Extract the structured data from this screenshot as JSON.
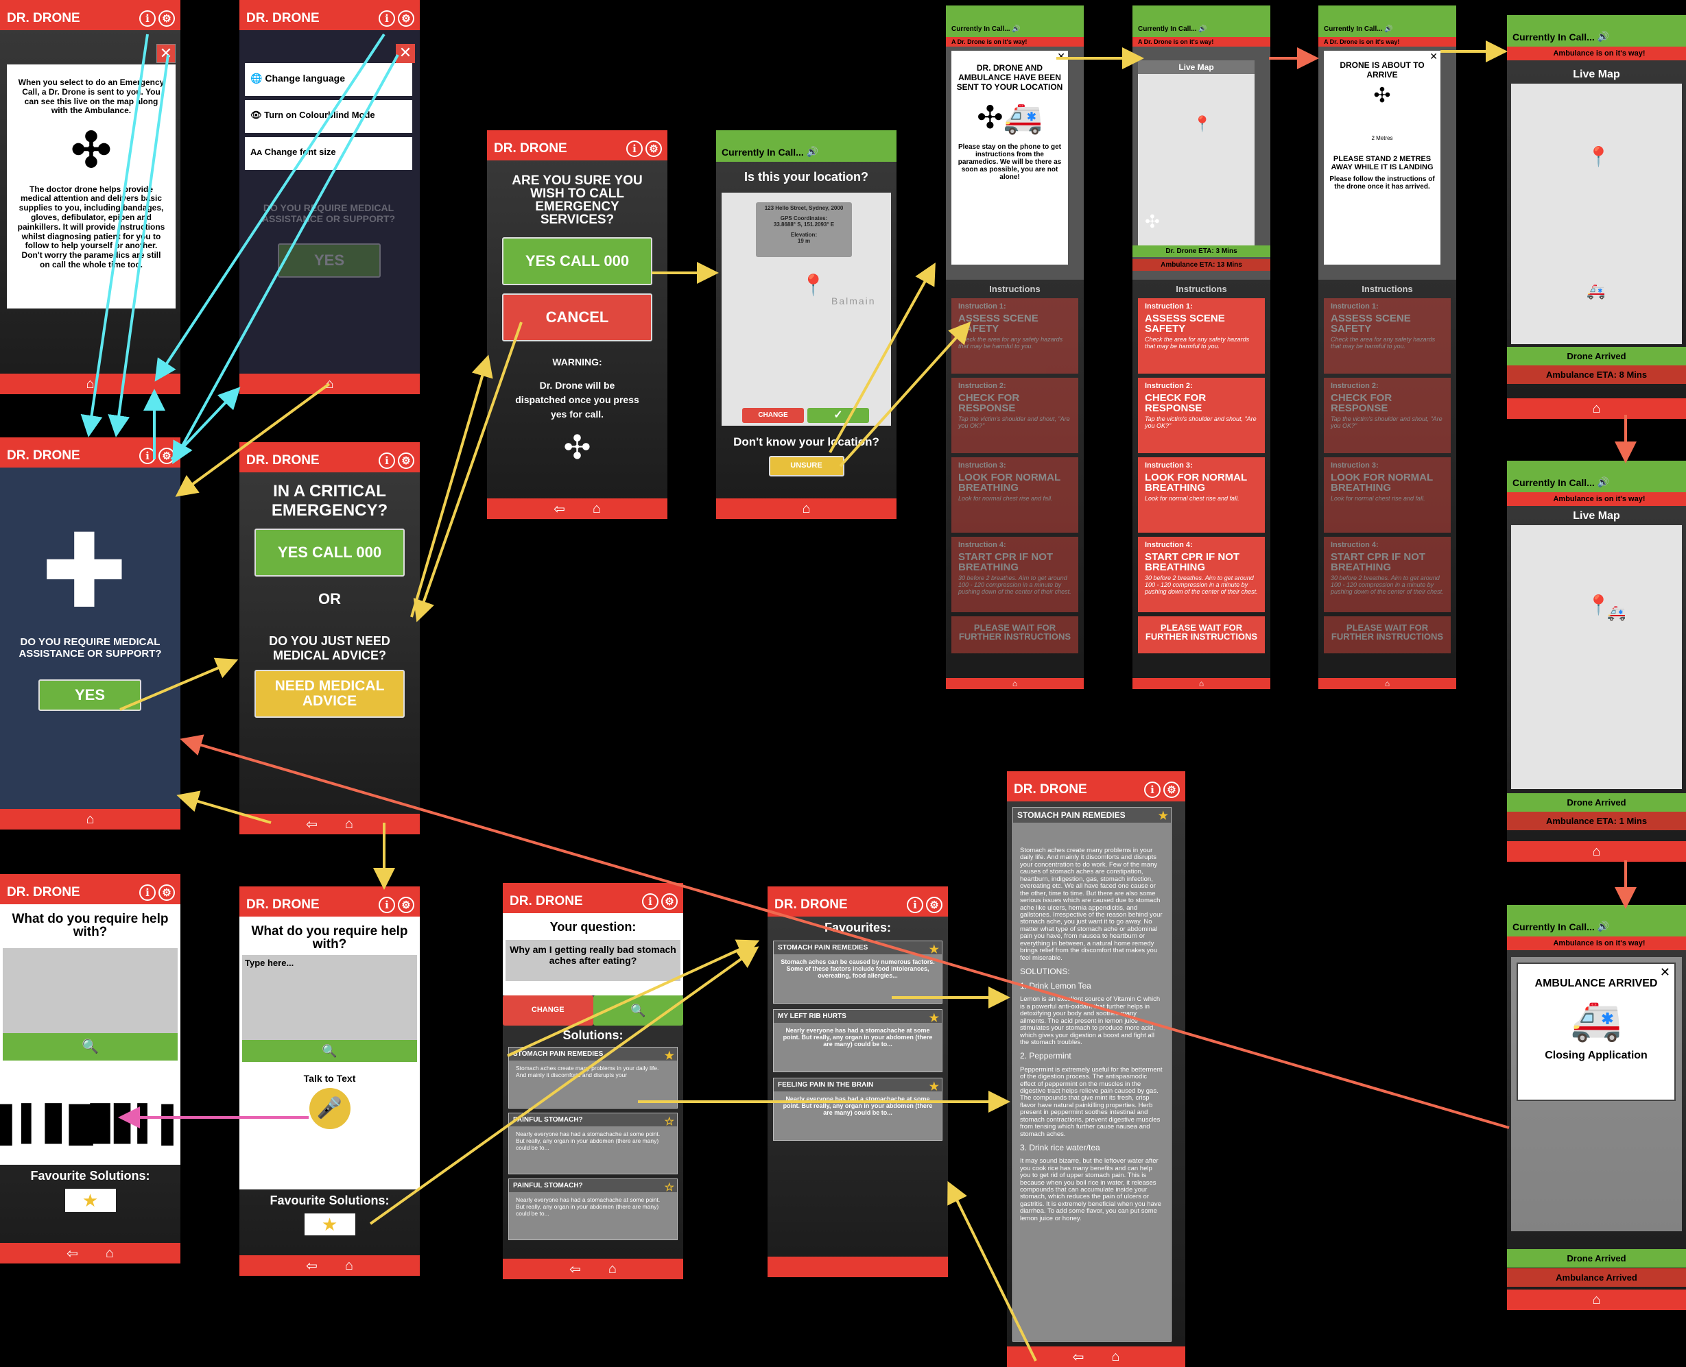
{
  "app": {
    "name": "DR. DRONE",
    "info": "i",
    "settings": "⚙",
    "home": "⌂",
    "back": "⇦"
  },
  "s1": {
    "text": "When you select to do an Emergency Call, a Dr. Drone is sent to you. You can see this live on the map along with the Ambulance.",
    "text2": "The doctor drone helps provide medical attention and delivers basic supplies to you, including bandages, gloves, defibulator, epipen and painkillers. It will provide instructions whilst diagnosing patient for you to follow to help yourself or another. Don't worry the paramedics are still on call the whole time too."
  },
  "s2": {
    "opt1": "Change language",
    "opt2": "Turn on Colourblind Mode",
    "opt3": "Change font size",
    "q": "DO YOU REQUIRE MEDICAL ASSISTANCE OR SUPPORT?",
    "yes": "YES"
  },
  "s3": {
    "q": "DO YOU REQUIRE MEDICAL ASSISTANCE OR SUPPORT?",
    "yes": "YES"
  },
  "s4": {
    "title": "IN A CRITICAL EMERGENCY?",
    "yes": "YES CALL 000",
    "or": "OR",
    "q2": "DO YOU JUST NEED MEDICAL ADVICE?",
    "advice": "NEED MEDICAL ADVICE"
  },
  "s5": {
    "title": "ARE YOU SURE YOU WISH TO CALL EMERGENCY SERVICES?",
    "yes": "YES CALL 000",
    "cancel": "CANCEL",
    "warn": "WARNING:",
    "warn2": "Dr. Drone will be dispatched once you press yes for call."
  },
  "s6": {
    "hdr": "Currently In Call...",
    "q": "Is this your location?",
    "addr": "123 Hello Street, Sydney, 2000",
    "gps": "GPS Coordinates:",
    "coords": "33.8688° S, 151.2093° E",
    "elev": "Elevation:",
    "elevv": "19 m",
    "change": "CHANGE",
    "unk": "Don't know your location?",
    "unsure": "UNSURE",
    "suburb": "Balmain"
  },
  "call": {
    "hdr": "Currently In Call...",
    "bar": "A Dr. Drone is on it's way!",
    "instr": "Instructions",
    "items": [
      {
        "t": "Instruction 1:",
        "h": "ASSESS SCENE SAFETY",
        "d": "Check the area for any safety hazards that may be harmful to you."
      },
      {
        "t": "Instruction 2:",
        "h": "CHECK FOR RESPONSE",
        "d": "Tap the victim's shoulder and shout, \"Are you OK?\""
      },
      {
        "t": "Instruction 3:",
        "h": "LOOK FOR NORMAL BREATHING",
        "d": "Look for normal chest rise and fall."
      },
      {
        "t": "Instruction 4:",
        "h": "START CPR IF NOT BREATHING",
        "d": "30 before 2 breathes. Aim to get around 100 - 120 compression in a minute by pushing down of the center of their chest."
      }
    ],
    "wait": "PLEASE WAIT FOR FURTHER INSTRUCTIONS",
    "pop1": "DR. DRONE AND AMBULANCE HAVE BEEN SENT TO YOUR LOCATION",
    "pop1b": "Please stay on the phone to get instructions from the paramedics. We will be there as soon as possible, you are not alone!",
    "live": "Live Map",
    "droneEta": "Dr. Drone ETA: 3 Mins",
    "ambEta": "Ambulance ETA: 13 Mins",
    "pop3": "DRONE IS ABOUT TO ARRIVE",
    "metres": "2 Metres",
    "pop3b": "PLEASE STAND 2 METRES AWAY WHILE IT IS LANDING",
    "pop3c": "Please follow the instructions of the drone once it has arrived."
  },
  "amb": {
    "bar": "Ambulance is on it's way!",
    "arrived": "Drone Arrived",
    "eta8": "Ambulance ETA: 8 Mins",
    "eta1": "Ambulance ETA: 1 Mins",
    "ambArr": "Ambulance Arrived",
    "pop": "AMBULANCE ARRIVED",
    "close": "Closing Application"
  },
  "help": {
    "q": "What do you require help with?",
    "type": "Type here...",
    "talk": "Talk to Text",
    "fav": "Favourite Solutions:"
  },
  "sol": {
    "your": "Your question:",
    "question": "Why am I getting really bad stomach aches after eating?",
    "change": "CHANGE",
    "solutions": "Solutions:",
    "cards": [
      {
        "h": "STOMACH PAIN REMEDIES",
        "b": "Stomach aches create many problems in your daily life. And mainly it discomforts and disrupts your"
      },
      {
        "h": "PAINFUL STOMACH?",
        "b": "Nearly everyone has had a stomachache at some point. But really, any organ in your abdomen (there are many) could be to..."
      },
      {
        "h": "PAINFUL STOMACH?",
        "b": "Nearly everyone has had a stomachache at some point. But really, any organ in your abdomen (there are many) could be to..."
      }
    ]
  },
  "fav": {
    "title": "Favourites:",
    "cards": [
      {
        "h": "STOMACH PAIN REMEDIES",
        "b": "Stomach aches can be caused by numerous factors. Some of these factors include food intolerances, overeating, food allergies..."
      },
      {
        "h": "MY LEFT RIB HURTS",
        "b": "Nearly everyone has had a stomachache at some point. But really, any organ in your abdomen (there are many) could be to..."
      },
      {
        "h": "FEELING PAIN IN THE BRAIN",
        "b": "Nearly everyone has had a stomachache at some point. But really, any organ in your abdomen (there are many) could be to..."
      }
    ]
  },
  "article": {
    "h": "STOMACH PAIN REMEDIES",
    "p1": "Stomach aches create many problems in your daily life. And mainly it discomforts and disrupts your concentration to do work. Few of the many causes of stomach aches are constipation, heartburn, indigestion, gas, stomach infection, overeating etc. We all have faced one cause or the other, time to time. But there are also some serious issues which are caused due to stomach ache like ulcers, hernia appendicitis, and gallstones. Irrespective of the reason behind your stomach ache, you just want it to go away. No matter what type of stomach ache or abdominal pain you have, from nausea to heartburn or everything in between, a natural home remedy brings relief from the discomfort that makes you feel miserable.",
    "sol": "SOLUTIONS:",
    "h1": "1. Drink Lemon Tea",
    "p2": "Lemon is an excellent source of Vitamin C which is a powerful anti-oxidant that further helps in detoxifying your body and soothes many ailments. The acid present in lemon juice stimulates your stomach to produce more acid, which gives your digestion a boost and fight all the stomach troubles.",
    "h2": "2. Peppermint",
    "p3": "Peppermint is extremely useful for the betterment of the digestion process. The antispasmodic effect of peppermint on the muscles in the digestive tract helps relieve pain caused by gas. The compounds that give mint its fresh, crisp flavor have natural painkilling properties. Herb present in peppermint soothes intestinal and stomach contractions, prevent digestive muscles from tensing which further cause nausea and stomach aches.",
    "h3": "3. Drink rice water/tea",
    "p4": "It may sound bizarre, but the leftover water after you cook rice has many benefits and can help you to get rid of upper stomach pain. This is because when you boil rice in water, it releases compounds that can accumulate inside your stomach, which reduces the pain of ulcers or gastritis. It is extremely beneficial when you have diarrhea. To add some flavor, you can put some lemon juice or honey."
  },
  "colors": {
    "red": "#e63a31",
    "green": "#6cb33f",
    "yellow": "#e8c03b",
    "cyan": "#5ee8f0",
    "salmon": "#f06a50",
    "pink": "#e860b0"
  }
}
